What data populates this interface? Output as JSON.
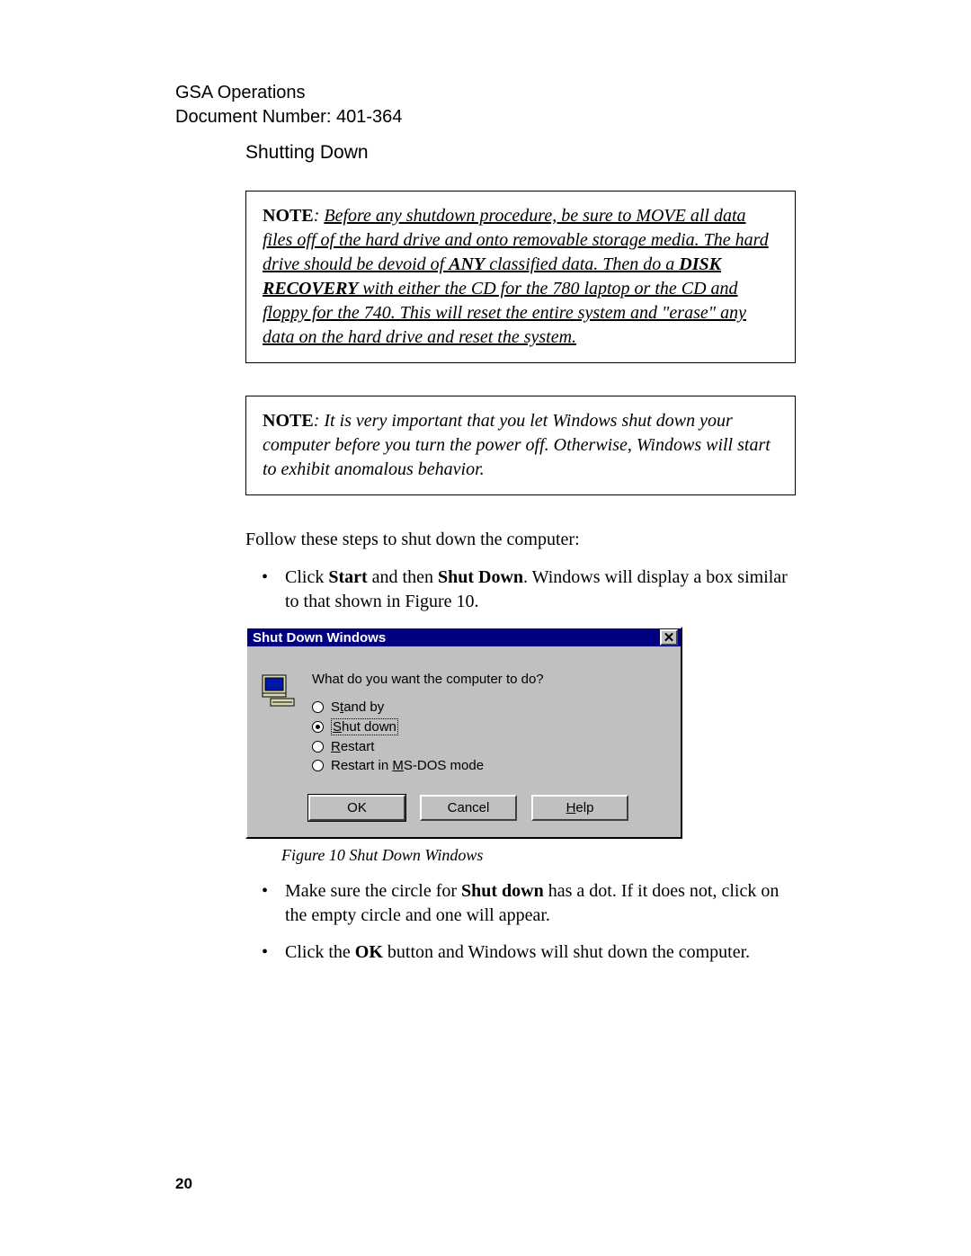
{
  "header": {
    "org": "GSA Operations",
    "doc": "Document Number: 401-364"
  },
  "section_title": "Shutting Down",
  "note1": {
    "label": "NOTE",
    "sep": ": ",
    "p1": "Before any shutdown procedure, be sure to MOVE all data files off of the hard drive and onto removable storage media. The hard drive should be devoid of ",
    "any": "ANY",
    "p2": " classified data. Then do a ",
    "disk": "DISK RECOVERY",
    "p3": " with either the CD for the 780 laptop or the CD and floppy for the 740. This will reset the entire system and \"erase\" any data on the hard drive and reset the system."
  },
  "note2": {
    "label": "NOTE",
    "sep": ": ",
    "text": "It is very important that you let Windows shut down your computer before you turn the power off. Otherwise, Windows will start to exhibit anomalous behavior."
  },
  "follow_text": "Follow these steps to shut down the computer:",
  "step1": {
    "t1": "Click ",
    "b1": "Start",
    "t2": " and then ",
    "b2": "Shut Down",
    "t3": ". Windows will display a box similar to that shown in Figure 10."
  },
  "dialog": {
    "title": "Shut Down Windows",
    "prompt": "What do you want the computer to do?",
    "options": {
      "standby": {
        "pre": "S",
        "u": "t",
        "post": "and by",
        "selected": false
      },
      "shutdown": {
        "pre": "",
        "u": "S",
        "post": "hut down",
        "selected": true
      },
      "restart": {
        "pre": "",
        "u": "R",
        "post": "estart",
        "selected": false
      },
      "msdos": {
        "pre": "Restart in ",
        "u": "M",
        "post": "S-DOS mode",
        "selected": false
      }
    },
    "buttons": {
      "ok": "OK",
      "cancel": "Cancel",
      "help": {
        "u": "H",
        "rest": "elp"
      }
    }
  },
  "fig_caption": "Figure 10 Shut Down Windows",
  "step2": {
    "t1": "Make sure the circle for ",
    "b1": "Shut down",
    "t2": " has a dot. If it does not, click on the empty circle and one will appear."
  },
  "step3": {
    "t1": "Click the ",
    "b1": "OK",
    "t2": " button and Windows will shut down the computer."
  },
  "page_number": "20"
}
